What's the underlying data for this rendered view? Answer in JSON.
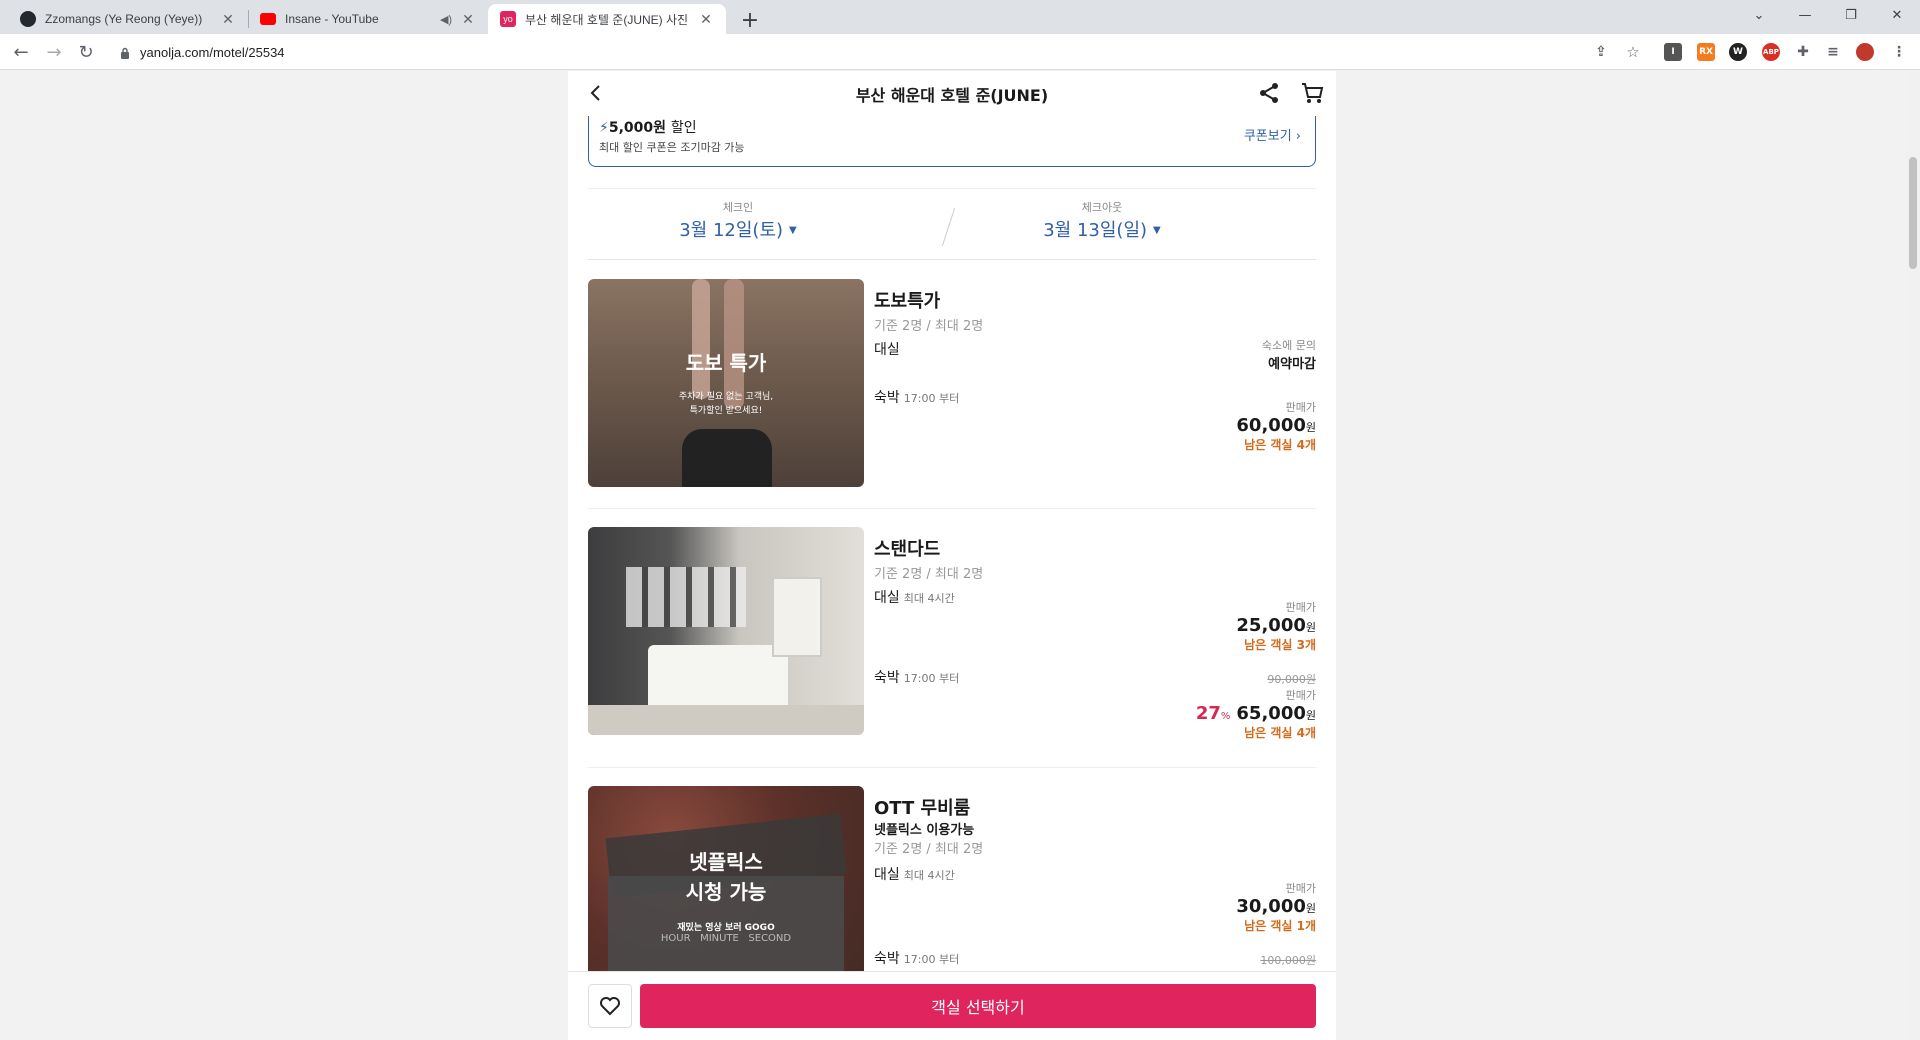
{
  "browser": {
    "tabs": [
      {
        "title": "Zzomangs (Ye Reong (Yeye))",
        "icon": "github-icon"
      },
      {
        "title": "Insane - YouTube",
        "icon": "youtube-icon"
      },
      {
        "title": "부산 해운대 호텔 준(JUNE) 사진",
        "icon": "yanolja-icon",
        "icon_text": "yo"
      }
    ],
    "url": "yanolja.com/motel/25534"
  },
  "header": {
    "title": "부산 해운대 호텔 준(JUNE)"
  },
  "coupon": {
    "amount": "5,000원",
    "amount_suffix": "할인",
    "subtitle": "최대 할인 쿠폰은 조기마감 가능",
    "view_label": "쿠폰보기"
  },
  "dates": {
    "checkin_label": "체크인",
    "checkin_value": "3월 12일(토)",
    "checkout_label": "체크아웃",
    "checkout_value": "3월 13일(일)"
  },
  "rooms": [
    {
      "name": "도보특가",
      "capacity": "기준 2명 / 최대 2명",
      "image_title": "도보 특가",
      "image_sub1": "주차가 필요 없는 고객님,",
      "image_sub2": "특가할인 받으세요!",
      "rental_label": "대실",
      "rental_note": "숙소에 문의",
      "rental_status": "예약마감",
      "stay_label": "숙박",
      "stay_time": "17:00 부터",
      "stay_price_label": "판매가",
      "stay_price": "60,000",
      "currency": "원",
      "stay_left": "남은 객실 4개"
    },
    {
      "name": "스탠다드",
      "capacity": "기준 2명 / 최대 2명",
      "rental_label": "대실",
      "rental_time": "최대 4시간",
      "rental_price_label": "판매가",
      "rental_price": "25,000",
      "rental_left": "남은 객실 3개",
      "stay_label": "숙박",
      "stay_time": "17:00 부터",
      "stay_orig": "90,000원",
      "stay_price_label": "판매가",
      "stay_discount": "27",
      "stay_discount_unit": "%",
      "stay_price": "65,000",
      "currency": "원",
      "stay_left": "남은 객실 4개"
    },
    {
      "name": "OTT 무비룸",
      "subname": "넷플릭스 이용가능",
      "capacity": "기준 2명 / 최대 2명",
      "image_title1": "넷플릭스",
      "image_title2": "시청 가능",
      "image_sub": "재밌는 영상 보러 GOGO",
      "image_clock": "HOUR   MINUTE   SECOND",
      "rental_label": "대실",
      "rental_time": "최대 4시간",
      "rental_price_label": "판매가",
      "rental_price": "30,000",
      "currency": "원",
      "rental_left": "남은 객실 1개",
      "stay_label": "숙박",
      "stay_time": "17:00 부터",
      "stay_orig": "100,000원"
    }
  ],
  "bottom": {
    "select_label": "객실 선택하기"
  },
  "colors": {
    "accent": "#3160a7",
    "cta": "#e0245e",
    "remaining": "#d46a1b",
    "discount": "#d6284e"
  }
}
